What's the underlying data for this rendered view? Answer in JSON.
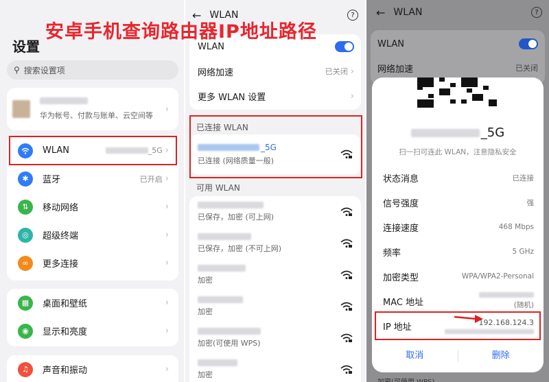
{
  "overlay_title": "安卓手机查询路由器IP地址路径",
  "settings": {
    "title": "设置",
    "search_placeholder": "搜索设置项",
    "account_sub": "华为帐号、付款与账单、云空间等",
    "items": [
      {
        "label": "WLAN",
        "value": "_5G",
        "color": "#2f7cf6",
        "icon": "wifi-icon"
      },
      {
        "label": "蓝牙",
        "value": "已开启",
        "color": "#2f7cf6",
        "icon": "bluetooth-icon"
      },
      {
        "label": "移动网络",
        "value": "",
        "color": "#39b54a",
        "icon": "mobile-network-icon"
      },
      {
        "label": "超级终端",
        "value": "",
        "color": "#2fb4a8",
        "icon": "super-device-icon"
      },
      {
        "label": "更多连接",
        "value": "",
        "color": "#f28a1e",
        "icon": "more-connections-icon"
      },
      {
        "label": "桌面和壁纸",
        "value": "",
        "color": "#39b54a",
        "icon": "wallpaper-icon"
      },
      {
        "label": "显示和亮度",
        "value": "",
        "color": "#39b54a",
        "icon": "display-icon"
      },
      {
        "label": "声音和振动",
        "value": "",
        "color": "#f0503c",
        "icon": "sound-icon"
      }
    ]
  },
  "wlan": {
    "header_title": "WLAN",
    "back_icon": "←",
    "help_icon": "?",
    "wlan_label": "WLAN",
    "net_accel_label": "网络加速",
    "net_accel_value": "已关闭",
    "more_settings_label": "更多 WLAN 设置",
    "connected_section": "已连接 WLAN",
    "connected_name": "_5G",
    "connected_status": "已连接 (网络质量一般)",
    "available_section": "可用 WLAN",
    "networks": [
      {
        "status": "已保存，加密 (可上网)"
      },
      {
        "status": "已保存，加密 (不可上网)"
      },
      {
        "status": "加密"
      },
      {
        "status": "加密"
      },
      {
        "status": "加密(可使用 WPS)"
      },
      {
        "status": "加密"
      }
    ]
  },
  "dialog": {
    "header_title": "WLAN",
    "wlan_label": "WLAN",
    "net_accel_label": "网络加速",
    "net_accel_value": "已关闭",
    "ssid": "_5G",
    "scan_hint": "扫一扫可连此 WLAN，注意隐私安全",
    "rows": [
      {
        "label": "状态消息",
        "value": "已连接"
      },
      {
        "label": "信号强度",
        "value": "强"
      },
      {
        "label": "连接速度",
        "value": "468 Mbps"
      },
      {
        "label": "频率",
        "value": "5 GHz"
      },
      {
        "label": "加密类型",
        "value": "WPA/WPA2-Personal"
      },
      {
        "label": "MAC 地址",
        "value": "(随机)"
      },
      {
        "label": "IP 地址",
        "value": "192.168.124.3"
      }
    ],
    "cancel_label": "取消",
    "delete_label": "删除",
    "bottom_peek": "加密(可使用 WPS)"
  }
}
